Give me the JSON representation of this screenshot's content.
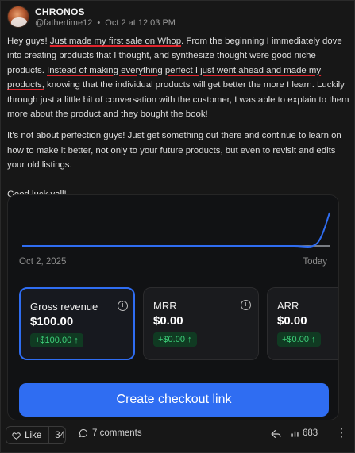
{
  "post": {
    "author": "CHRONOS",
    "handle": "@fathertime12",
    "dot": "•",
    "timestamp": "Oct 2 at 12:03 PM",
    "paragraph1": {
      "p1a": "Hey guys! ",
      "p1b": "Just made my first sale on Whop",
      "p1c": ". From the beginning I immediately dove into creating products that I thought, and synthesize thought were good niche products. ",
      "p1d": "Instead of making everything perfect I just went ahead and made my products,",
      "p1e": " knowing that the individual products will get better the more I learn. Luckily through just a little bit of conversation with the customer, I was able to explain to them more about the product and they bought the book!"
    },
    "paragraph2": "It's not about perfection guys! Just get something out there and continue to learn on how to make it better, not only to your future products, but even to revisit and edits your old listings.",
    "paragraph3": "Good luck yall!"
  },
  "dashboard": {
    "date_start": "Oct 2, 2025",
    "date_end": "Today",
    "metrics": [
      {
        "title": "Gross revenue",
        "value": "$100.00",
        "change": "+$100.00 ↑",
        "active": true
      },
      {
        "title": "MRR",
        "value": "$0.00",
        "change": "+$0.00 ↑",
        "active": false
      },
      {
        "title": "ARR",
        "value": "$0.00",
        "change": "+$0.00 ↑",
        "active": false
      }
    ],
    "cta_label": "Create checkout link",
    "accent_color": "#2f6df2",
    "positive_color": "#3ed07a"
  },
  "footer": {
    "like_label": "Like",
    "like_count": "34",
    "comments_label": "7 comments",
    "views_count": "683",
    "more_label": "⋮"
  },
  "icons": [
    "heart-icon",
    "comment-icon",
    "share-icon",
    "views-icon",
    "info-icon",
    "more-icon"
  ]
}
